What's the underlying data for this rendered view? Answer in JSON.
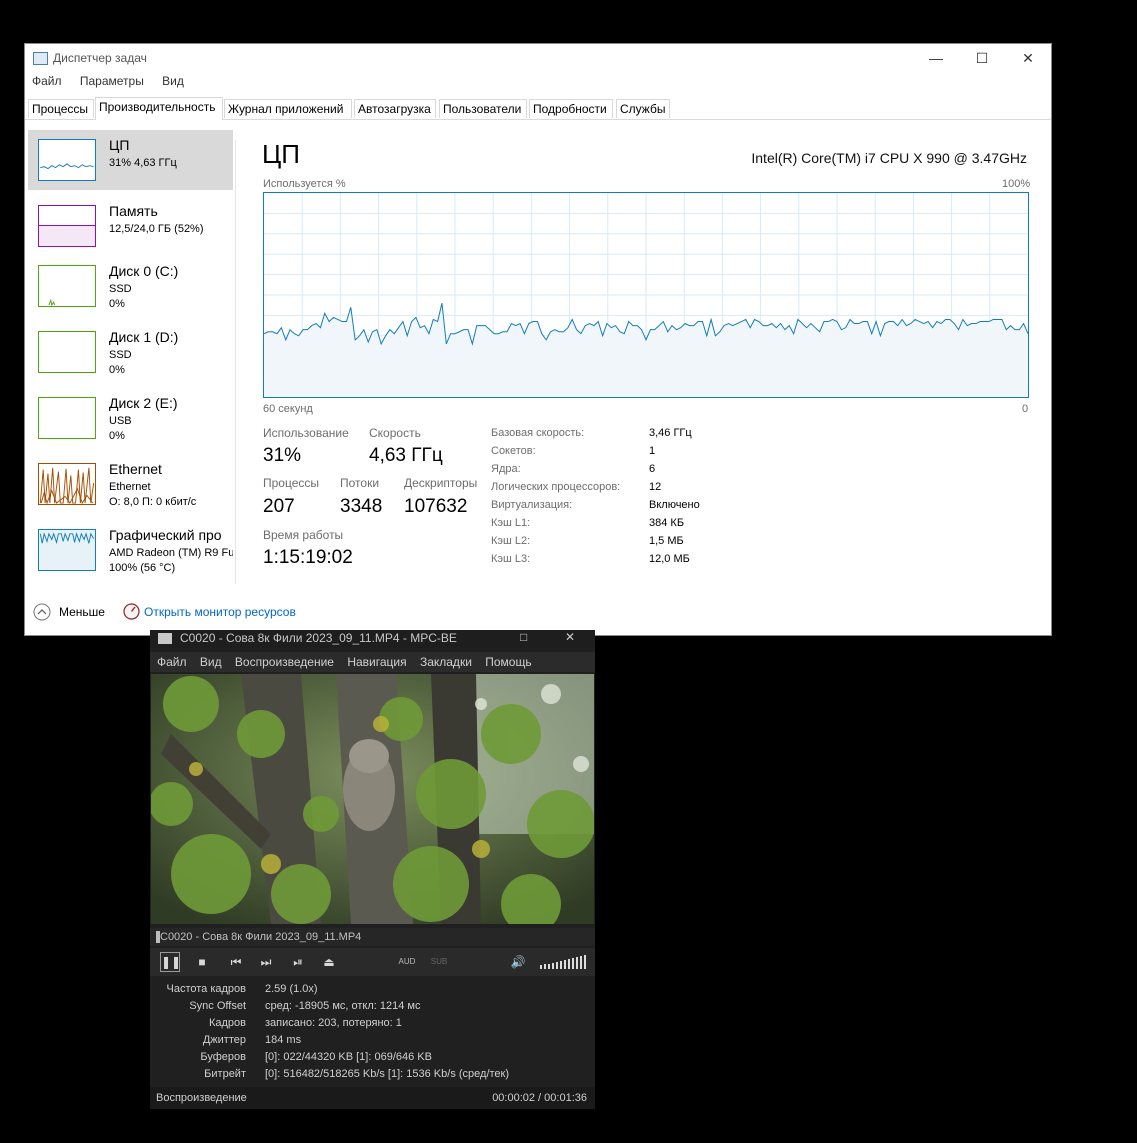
{
  "taskmgr": {
    "title": "Диспетчер задач",
    "menu": [
      "Файл",
      "Параметры",
      "Вид"
    ],
    "tabs": [
      "Процессы",
      "Производительность",
      "Журнал приложений",
      "Автозагрузка",
      "Пользователи",
      "Подробности",
      "Службы"
    ],
    "active_tab": "Производительность",
    "sidebar": [
      {
        "name": "ЦП",
        "line2": "31% 4,63 ГГц",
        "line3": "",
        "color": "#117dbb"
      },
      {
        "name": "Память",
        "line2": "12,5/24,0 ГБ (52%)",
        "line3": "",
        "color": "#8b12ae"
      },
      {
        "name": "Диск 0 (C:)",
        "line2": "SSD",
        "line3": "0%",
        "color": "#4da60c"
      },
      {
        "name": "Диск 1 (D:)",
        "line2": "SSD",
        "line3": "0%",
        "color": "#4da60c"
      },
      {
        "name": "Диск 2 (E:)",
        "line2": "USB",
        "line3": "0%",
        "color": "#4da60c"
      },
      {
        "name": "Ethernet",
        "line2": "Ethernet",
        "line3": "О: 8,0 П: 0 кбит/с",
        "color": "#a74f01"
      },
      {
        "name": "Графический про",
        "line2": "AMD Radeon (TM) R9 Fu",
        "line3": "100% (56 °C)",
        "color": "#117dbb"
      }
    ],
    "cpu": {
      "title": "ЦП",
      "model": "Intel(R) Core(TM) i7 CPU X 990 @ 3.47GHz",
      "graph_label": "Используется %",
      "graph_max": "100%",
      "graph_time": "60 секунд",
      "graph_min": "0",
      "usage_history": [
        31,
        32,
        32,
        31,
        34,
        28,
        33,
        31,
        30,
        33,
        33,
        35,
        36,
        34,
        41,
        37,
        39,
        38,
        37,
        37,
        44,
        28,
        30,
        33,
        27,
        32,
        33,
        26,
        30,
        33,
        31,
        34,
        37,
        30,
        37,
        39,
        34,
        35,
        31,
        38,
        37,
        46,
        26,
        31,
        31,
        32,
        33,
        33,
        26,
        35,
        35,
        35,
        33,
        31,
        31,
        32,
        32,
        36,
        35,
        36,
        31,
        36,
        37,
        37,
        31,
        28,
        32,
        33,
        32,
        32,
        34,
        38,
        33,
        31,
        35,
        36,
        35,
        37,
        30,
        36,
        34,
        35,
        32,
        31,
        37,
        35,
        35,
        33,
        28,
        33,
        33,
        35,
        37,
        32,
        35,
        33,
        34,
        36,
        35,
        35,
        37,
        37,
        30,
        38,
        30,
        32,
        35,
        36,
        35,
        36,
        37,
        38,
        34,
        38,
        37,
        35,
        35,
        36,
        34,
        36,
        33,
        35,
        31,
        38,
        36,
        34,
        36,
        34,
        32,
        37,
        37,
        38,
        37,
        33,
        34,
        38,
        36,
        36,
        37,
        37,
        31,
        37,
        30,
        36,
        37,
        37,
        35,
        38,
        35,
        36,
        38,
        37,
        36,
        37,
        34,
        37,
        36,
        38,
        38,
        36,
        33,
        38,
        35,
        36,
        36,
        37,
        37,
        37,
        38,
        38,
        38,
        33,
        35,
        33,
        33,
        36,
        31
      ],
      "usage_label": "Использование",
      "usage_value": "31%",
      "speed_label": "Скорость",
      "speed_value": "4,63 ГГц",
      "processes_label": "Процессы",
      "processes_value": "207",
      "threads_label": "Потоки",
      "threads_value": "3348",
      "handles_label": "Дескрипторы",
      "handles_value": "107632",
      "uptime_label": "Время работы",
      "uptime_value": "1:15:19:02",
      "info": [
        {
          "k": "Базовая скорость:",
          "v": "3,46 ГГц"
        },
        {
          "k": "Сокетов:",
          "v": "1"
        },
        {
          "k": "Ядра:",
          "v": "6"
        },
        {
          "k": "Логических процессоров:",
          "v": "12"
        },
        {
          "k": "Виртуализация:",
          "v": "Включено"
        },
        {
          "k": "Кэш L1:",
          "v": "384 КБ"
        },
        {
          "k": "Кэш L2:",
          "v": "1,5 МБ"
        },
        {
          "k": "Кэш L3:",
          "v": "12,0 МБ"
        }
      ]
    },
    "footer": {
      "less": "Меньше",
      "monitor": "Открыть монитор ресурсов"
    }
  },
  "mpc": {
    "title": "C0020 - Сова 8к Фили 2023_09_11.MP4 - MPC-BE ...",
    "menu": [
      "Файл",
      "Вид",
      "Воспроизведение",
      "Навигация",
      "Закладки",
      "Помощь"
    ],
    "filename": "C0020 - Сова 8к Фили 2023_09_11.MP4",
    "aud": "AUD",
    "sub": "SUB",
    "stats": [
      {
        "k": "Частота кадров",
        "v": "2.59  (1.0x)"
      },
      {
        "k": "Sync Offset",
        "v": "сред: -18905 мс, откл: 1214 мс"
      },
      {
        "k": "Кадров",
        "v": "записано: 203, потеряно: 1"
      },
      {
        "k": "Джиттер",
        "v": "184 ms"
      },
      {
        "k": "Буферов",
        "v": "[0]: 022/44320 KB [1]: 069/646 KB"
      },
      {
        "k": "Битрейт",
        "v": "[0]: 516482/518265 Kb/s [1]: 1536 Kb/s (сред/тек)"
      }
    ],
    "status_left": "Воспроизведение",
    "status_right": "00:00:02 / 00:01:36"
  }
}
